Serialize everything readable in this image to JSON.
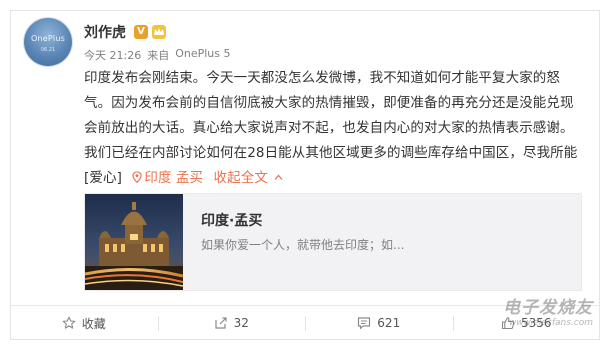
{
  "author": {
    "name": "刘作虎",
    "verified_icon": "verified-v-icon",
    "member_icon": "member-crown-icon",
    "avatar": {
      "brand": "OnePlus",
      "date": "06.21"
    }
  },
  "meta": {
    "time": "今天 21:26",
    "source_prefix": "来自",
    "source": "OnePlus 5"
  },
  "post": {
    "text": "印度发布会刚结束。今天一天都没怎么发微博，我不知道如何才能平复大家的怒气。因为发布会前的自信彻底被大家的热情摧毁，即便准备的再充分还是没能兑现会前放出的大话。真心给大家说声对不起，也发自内心的对大家的热情表示感谢。我们已经在内部讨论如何在28日能从其他区域更多的调些库存给中国区，尽我所能[爱心]",
    "location_icon": "location-pin-icon",
    "location": "印度 孟买",
    "expand": "收起全文",
    "expand_icon": "chevron-up-icon"
  },
  "card": {
    "title": "印度·孟买",
    "description": "如果你爱一个人，就带他去印度；如..."
  },
  "actions": {
    "favorite": {
      "icon": "star-icon",
      "label": "收藏"
    },
    "repost": {
      "icon": "repost-icon",
      "count": "32"
    },
    "comment": {
      "icon": "comment-icon",
      "count": "621"
    },
    "like": {
      "icon": "thumbs-up-icon",
      "count": "5356"
    }
  },
  "watermark": {
    "main": "电子发烧友",
    "url": "www.elecfans.com"
  },
  "colors": {
    "link": "#eb7350",
    "text": "#333333",
    "muted": "#808080",
    "verified": "#e8a12a"
  }
}
